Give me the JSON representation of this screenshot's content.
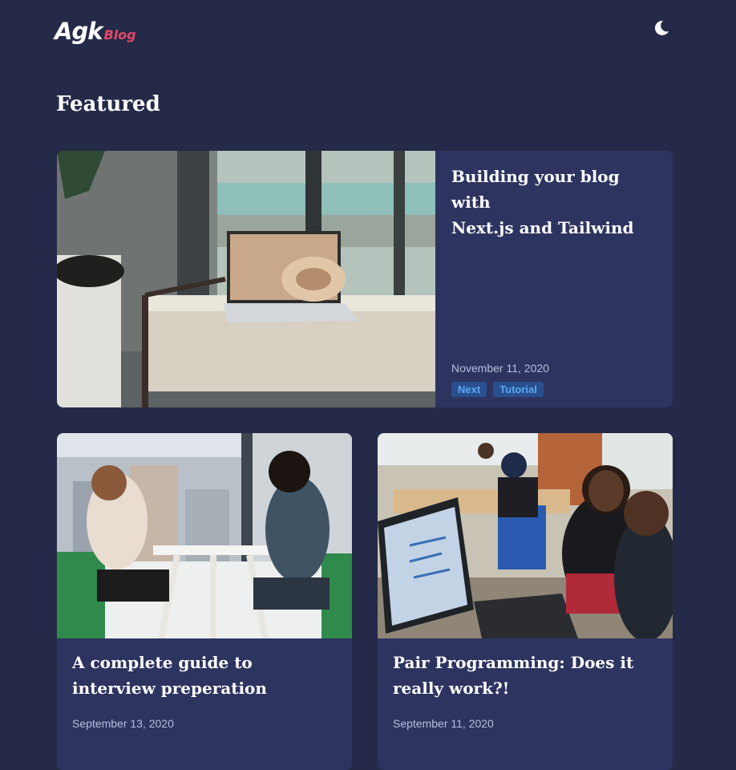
{
  "brand": {
    "name": "Agk",
    "suffix": "Blog"
  },
  "header": {
    "theme_toggle_icon": "moon-icon"
  },
  "featured_section": {
    "title": "Featured"
  },
  "featured_post": {
    "title_line1": "Building your blog with",
    "title_line2": "Next.js and Tailwind",
    "date": "November 11, 2020",
    "tags": [
      "Next",
      "Tutorial"
    ]
  },
  "posts": [
    {
      "title_line1": "A complete guide to",
      "title_line2": "interview preperation",
      "date": "September 13, 2020"
    },
    {
      "title_line1": "Pair Programming: Does it",
      "title_line2": "really work?!",
      "date": "September 11, 2020"
    }
  ],
  "colors": {
    "background": "#252a48",
    "card": "#2e3460",
    "brand_accent": "#e44868",
    "tag_bg": "#2a4f8e",
    "tag_text": "#5aa7f2"
  }
}
